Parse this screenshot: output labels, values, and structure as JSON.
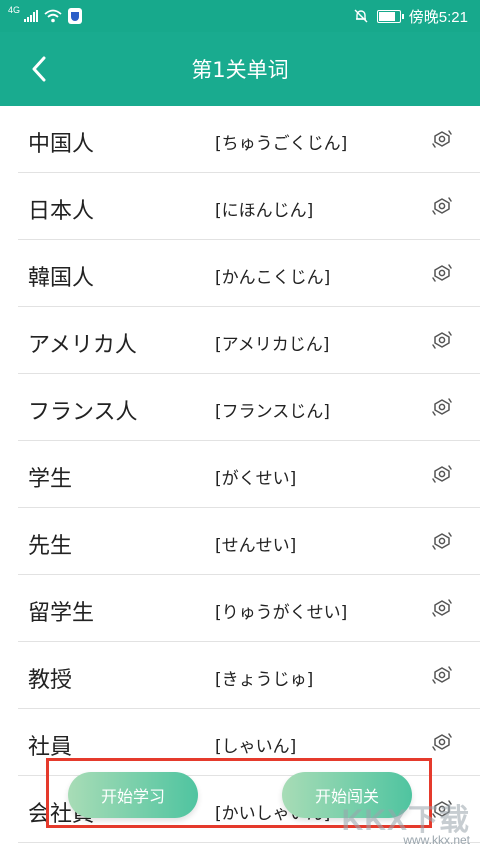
{
  "status_bar": {
    "network": "4G",
    "time": "傍晚5:21"
  },
  "header": {
    "title": "第1关单词"
  },
  "words": [
    {
      "word": "中国人",
      "reading": "[ちゅうごくじん]"
    },
    {
      "word": "日本人",
      "reading": "[にほんじん]"
    },
    {
      "word": "韓国人",
      "reading": "[かんこくじん]"
    },
    {
      "word": "アメリカ人",
      "reading": "[アメリカじん]"
    },
    {
      "word": "フランス人",
      "reading": "[フランスじん]"
    },
    {
      "word": "学生",
      "reading": "[がくせい]"
    },
    {
      "word": "先生",
      "reading": "[せんせい]"
    },
    {
      "word": "留学生",
      "reading": "[りゅうがくせい]"
    },
    {
      "word": "教授",
      "reading": "[きょうじゅ]"
    },
    {
      "word": "社員",
      "reading": "[しゃいん]"
    },
    {
      "word": "会社員",
      "reading": "[かいしゃいん]"
    }
  ],
  "actions": {
    "start_study": "开始学习",
    "start_challenge": "开始闯关"
  },
  "watermark": {
    "brand": "KKX下载",
    "url": "www.kkx.net"
  },
  "colors": {
    "primary": "#19ab8f",
    "highlight_box": "#e53a2c"
  },
  "icons": [
    "back-arrow-icon",
    "speaker-icon",
    "mute-bell-icon",
    "battery-icon",
    "wifi-icon",
    "signal-icon"
  ]
}
